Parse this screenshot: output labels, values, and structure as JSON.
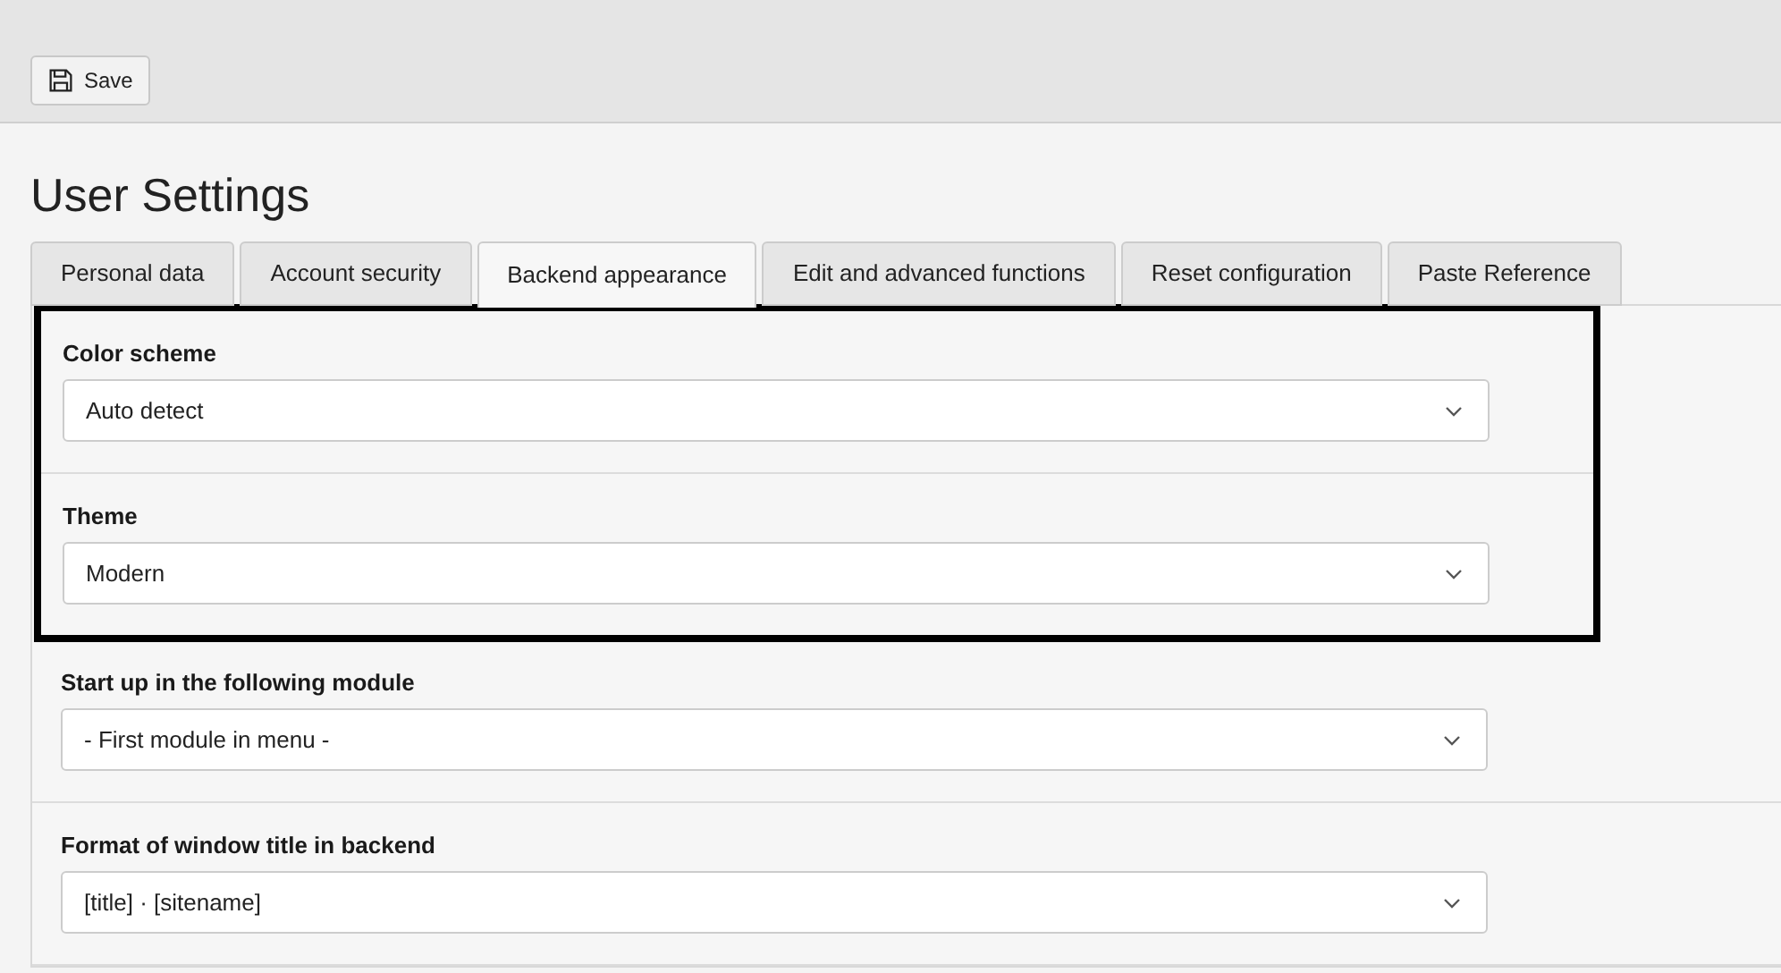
{
  "toolbar": {
    "save_button": "Save"
  },
  "title": "User Settings",
  "tabs": [
    {
      "label": "Personal data",
      "selected": false
    },
    {
      "label": "Account security",
      "selected": false
    },
    {
      "label": "Backend appearance",
      "selected": true
    },
    {
      "label": "Edit and advanced functions",
      "selected": false
    },
    {
      "label": "Reset configuration",
      "selected": false
    },
    {
      "label": "Paste Reference",
      "selected": false
    }
  ],
  "fields": [
    {
      "label": "Color scheme",
      "value": "Auto detect",
      "highlighted": true
    },
    {
      "label": "Theme",
      "value": "Modern",
      "highlighted": true
    },
    {
      "label": "Start up in the following module",
      "value": "- First module in menu -",
      "highlighted": false
    },
    {
      "label": "Format of window title in backend",
      "value": "[title] · [sitename]",
      "highlighted": false
    }
  ]
}
